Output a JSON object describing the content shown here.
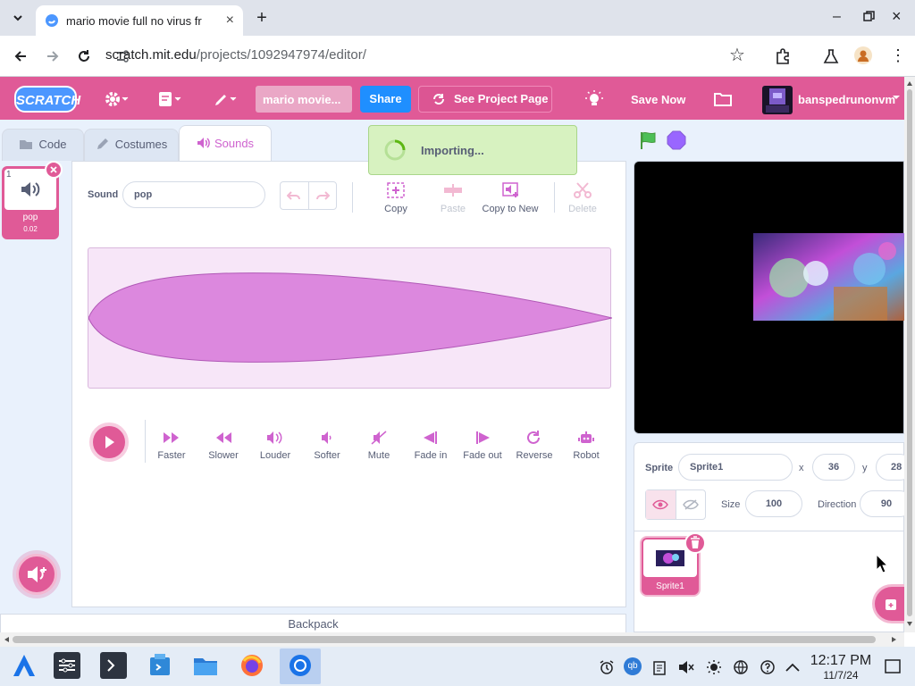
{
  "browser": {
    "tab_title": "mario movie full no virus fr",
    "url_host": "scratch.mit.edu",
    "url_path": "/projects/1092947974/editor/"
  },
  "menubar": {
    "logo": "SCRATCH",
    "project_title": "mario movie...",
    "share_label": "Share",
    "see_project_label": "See Project Page",
    "save_now_label": "Save Now",
    "username": "banspedrunonvm"
  },
  "tabs": [
    {
      "label": "Code"
    },
    {
      "label": "Costumes"
    },
    {
      "label": "Sounds"
    }
  ],
  "sound_list": [
    {
      "index": "1",
      "name": "pop",
      "duration": "0.02"
    }
  ],
  "sound_editor": {
    "sound_label": "Sound",
    "sound_name": "pop",
    "tools": [
      {
        "label": "Copy",
        "enabled": true
      },
      {
        "label": "Paste",
        "enabled": false
      },
      {
        "label": "Copy to New",
        "enabled": true
      },
      {
        "label": "Delete",
        "enabled": false
      }
    ],
    "effects": [
      {
        "label": "Faster"
      },
      {
        "label": "Slower"
      },
      {
        "label": "Louder"
      },
      {
        "label": "Softer"
      },
      {
        "label": "Mute"
      },
      {
        "label": "Fade in"
      },
      {
        "label": "Fade out"
      },
      {
        "label": "Reverse"
      },
      {
        "label": "Robot"
      }
    ]
  },
  "backpack_label": "Backpack",
  "importing_text": "Importing...",
  "sprite_info": {
    "sprite_label": "Sprite",
    "sprite_name": "Sprite1",
    "x_label": "x",
    "x_value": "36",
    "y_label": "y",
    "y_value": "28",
    "size_label": "Size",
    "size_value": "100",
    "direction_label": "Direction",
    "direction_value": "90"
  },
  "sprites": [
    {
      "name": "Sprite1"
    }
  ],
  "taskbar": {
    "time": "12:17 PM",
    "date": "11/7/24"
  },
  "colors": {
    "menu_pink": "#e05a97",
    "share_blue": "#1f8fff",
    "waveform": "#cf63cf",
    "importing_bg": "#d7f2c0"
  }
}
